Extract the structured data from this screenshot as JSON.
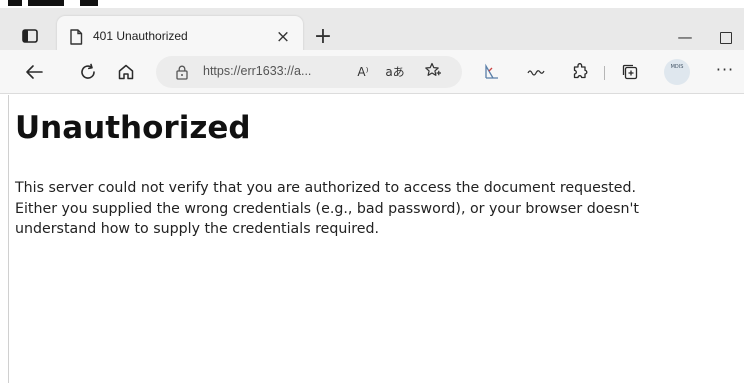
{
  "browser": {
    "tab": {
      "title": "401 Unauthorized",
      "close_glyph": "×"
    },
    "new_tab_glyph": "+",
    "window": {
      "minimize_glyph": "—"
    },
    "address_bar": {
      "url": "https://err1633://a...",
      "read_aloud": "A⁾",
      "translate": "aあ"
    },
    "more_glyph": "···",
    "profile_chip_text": "MDIS"
  },
  "page": {
    "heading": "Unauthorized",
    "body_lines": [
      "This server could not verify that you are authorized to access the document requested.",
      "Either you supplied the wrong credentials (e.g., bad password), or your browser doesn't",
      "understand how to supply the credentials required."
    ]
  },
  "colors": {
    "tab_strip": "#e9e9e9",
    "toolbar": "#f7f7f7",
    "address_field": "#ececec",
    "page_background": "#ffffff",
    "text": "#222222"
  },
  "icons": [
    "tab-actions-icon",
    "page-icon",
    "back-arrow-icon",
    "refresh-icon",
    "home-icon",
    "lock-icon",
    "favorite-star-icon",
    "extension-draw-icon",
    "extension-icon",
    "collections-icon"
  ]
}
